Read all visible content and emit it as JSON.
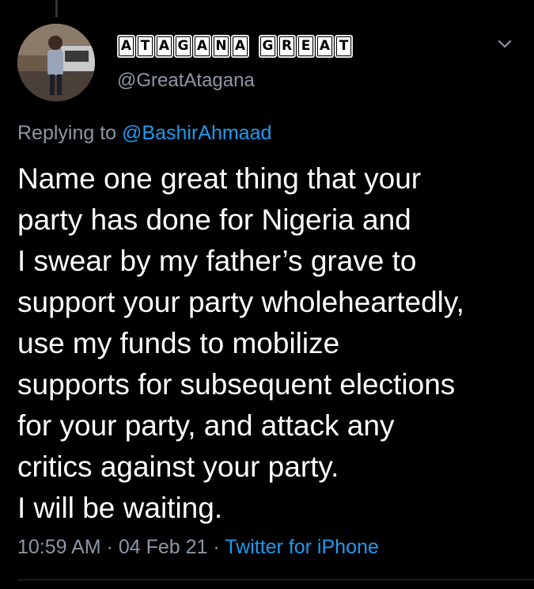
{
  "user": {
    "display_name_words": [
      [
        "A",
        "T",
        "A",
        "G",
        "A",
        "N",
        "A"
      ],
      [
        "G",
        "R",
        "E",
        "A",
        "T"
      ]
    ],
    "handle": "@GreatAtagana",
    "avatar_icon": "user-photo"
  },
  "reply": {
    "prefix": "Replying to",
    "mention": "@BashirAhmaad"
  },
  "tweet": {
    "text": "Name one great thing that your\nparty has done for Nigeria and\nI swear by my father’s grave to\nsupport your party wholeheartedly,\nuse my funds to mobilize\nsupports for subsequent elections\nfor your party, and attack any\ncritics against your party.\nI will be waiting."
  },
  "meta": {
    "time": "10:59 AM",
    "date": "04 Feb 21",
    "separator": "·",
    "source": "Twitter for iPhone"
  },
  "colors": {
    "background": "#000000",
    "text": "#ffffff",
    "secondary": "#8b98a5",
    "link": "#1d9bf0"
  },
  "icons": {
    "more": "chevron-down-icon"
  }
}
